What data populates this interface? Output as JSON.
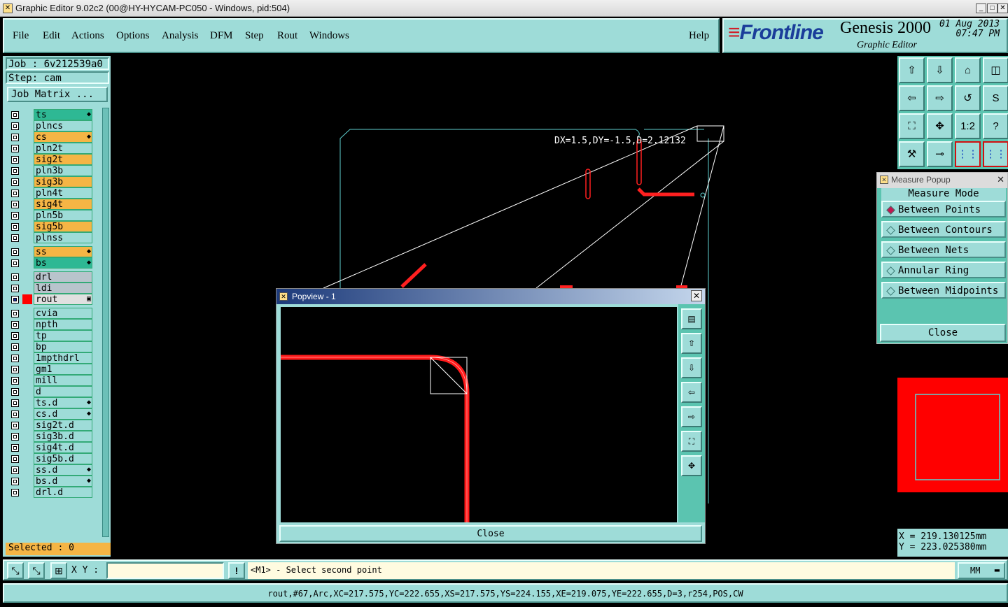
{
  "window": {
    "title": "Graphic Editor 9.02c2 (00@HY-HYCAM-PC050 - Windows, pid:504)"
  },
  "menu": {
    "items": [
      {
        "label": "File"
      },
      {
        "label": "Edit"
      },
      {
        "label": "Actions"
      },
      {
        "label": "Options"
      },
      {
        "label": "Analysis"
      },
      {
        "label": "DFM"
      },
      {
        "label": "Step"
      },
      {
        "label": "Rout"
      },
      {
        "label": "Windows"
      }
    ],
    "help": "Help"
  },
  "logo": {
    "brand": "Frontline",
    "product": "Genesis 2000",
    "subtitle": "Graphic Editor",
    "date": "01 Aug 2013",
    "time": "07:47 PM"
  },
  "job": {
    "job_label": "Job : 6v212539a0",
    "step_label": "Step: cam",
    "matrix_button": "Job Matrix ..."
  },
  "layers": [
    {
      "name": "ts",
      "color": "#2eb894",
      "mark": "◆"
    },
    {
      "name": "plncs",
      "color": "#9edcd8"
    },
    {
      "name": "cs",
      "color": "#f5b545",
      "mark": "◆"
    },
    {
      "name": "pln2t",
      "color": "#9edcd8"
    },
    {
      "name": "sig2t",
      "color": "#f5b545"
    },
    {
      "name": "pln3b",
      "color": "#9edcd8"
    },
    {
      "name": "sig3b",
      "color": "#f5b545"
    },
    {
      "name": "pln4t",
      "color": "#9edcd8"
    },
    {
      "name": "sig4t",
      "color": "#f5b545"
    },
    {
      "name": "pln5b",
      "color": "#9edcd8"
    },
    {
      "name": "sig5b",
      "color": "#f5b545"
    },
    {
      "name": "plnss",
      "color": "#9edcd8"
    },
    {
      "name": "ss",
      "color": "#f5b545",
      "mark": "◆"
    },
    {
      "name": "bs",
      "color": "#2eb894",
      "mark": "◆"
    },
    {
      "name": "drl",
      "color": "#b8c4cc"
    },
    {
      "name": "ldi",
      "color": "#b8c4cc"
    },
    {
      "name": "rout",
      "color": "#e0e0e0",
      "mark": "▣"
    },
    {
      "name": "cvia",
      "color": "#9edcd8"
    },
    {
      "name": "npth",
      "color": "#9edcd8"
    },
    {
      "name": "tp",
      "color": "#9edcd8"
    },
    {
      "name": "bp",
      "color": "#9edcd8"
    },
    {
      "name": "1mpthdrl",
      "color": "#9edcd8"
    },
    {
      "name": "gm1",
      "color": "#9edcd8"
    },
    {
      "name": "mill",
      "color": "#9edcd8"
    },
    {
      "name": "d",
      "color": "#9edcd8"
    },
    {
      "name": "ts.d",
      "color": "#9edcd8",
      "mark": "◆"
    },
    {
      "name": "cs.d",
      "color": "#9edcd8",
      "mark": "◆"
    },
    {
      "name": "sig2t.d",
      "color": "#9edcd8"
    },
    {
      "name": "sig3b.d",
      "color": "#9edcd8"
    },
    {
      "name": "sig4t.d",
      "color": "#9edcd8"
    },
    {
      "name": "sig5b.d",
      "color": "#9edcd8"
    },
    {
      "name": "ss.d",
      "color": "#9edcd8",
      "mark": "◆"
    },
    {
      "name": "bs.d",
      "color": "#9edcd8",
      "mark": "◆"
    },
    {
      "name": "drl.d",
      "color": "#9edcd8"
    }
  ],
  "selected": "Selected : 0",
  "canvas": {
    "measure_text": "DX=1.5,DY=-1.5,D=2.12132"
  },
  "measure_popup": {
    "title": "Measure Popup",
    "header": "Measure Mode",
    "options": [
      {
        "label": "Between Points"
      },
      {
        "label": "Between Contours"
      },
      {
        "label": "Between Nets"
      },
      {
        "label": "Annular Ring"
      },
      {
        "label": "Between Midpoints"
      }
    ],
    "selected_option": "Between Points",
    "close": "Close"
  },
  "popview": {
    "title": "Popview - 1",
    "close": "Close"
  },
  "coords": {
    "x": "X = 219.130125mm",
    "y": "Y = 223.025380mm"
  },
  "command": {
    "xy_label": "X Y :",
    "xy_value": "",
    "prompt": "<M1> - Select second point",
    "units": "MM"
  },
  "status": "rout,#67,Arc,XC=217.575,YC=222.655,XS=217.575,YS=224.155,XE=219.075,YE=222.655,D=3,r254,POS,CW",
  "colors": {
    "panel": "#9edcd8",
    "accent": "#5bc4b0",
    "orange": "#f5b545",
    "green": "#2eb894",
    "rout_line": "#ff0000"
  }
}
